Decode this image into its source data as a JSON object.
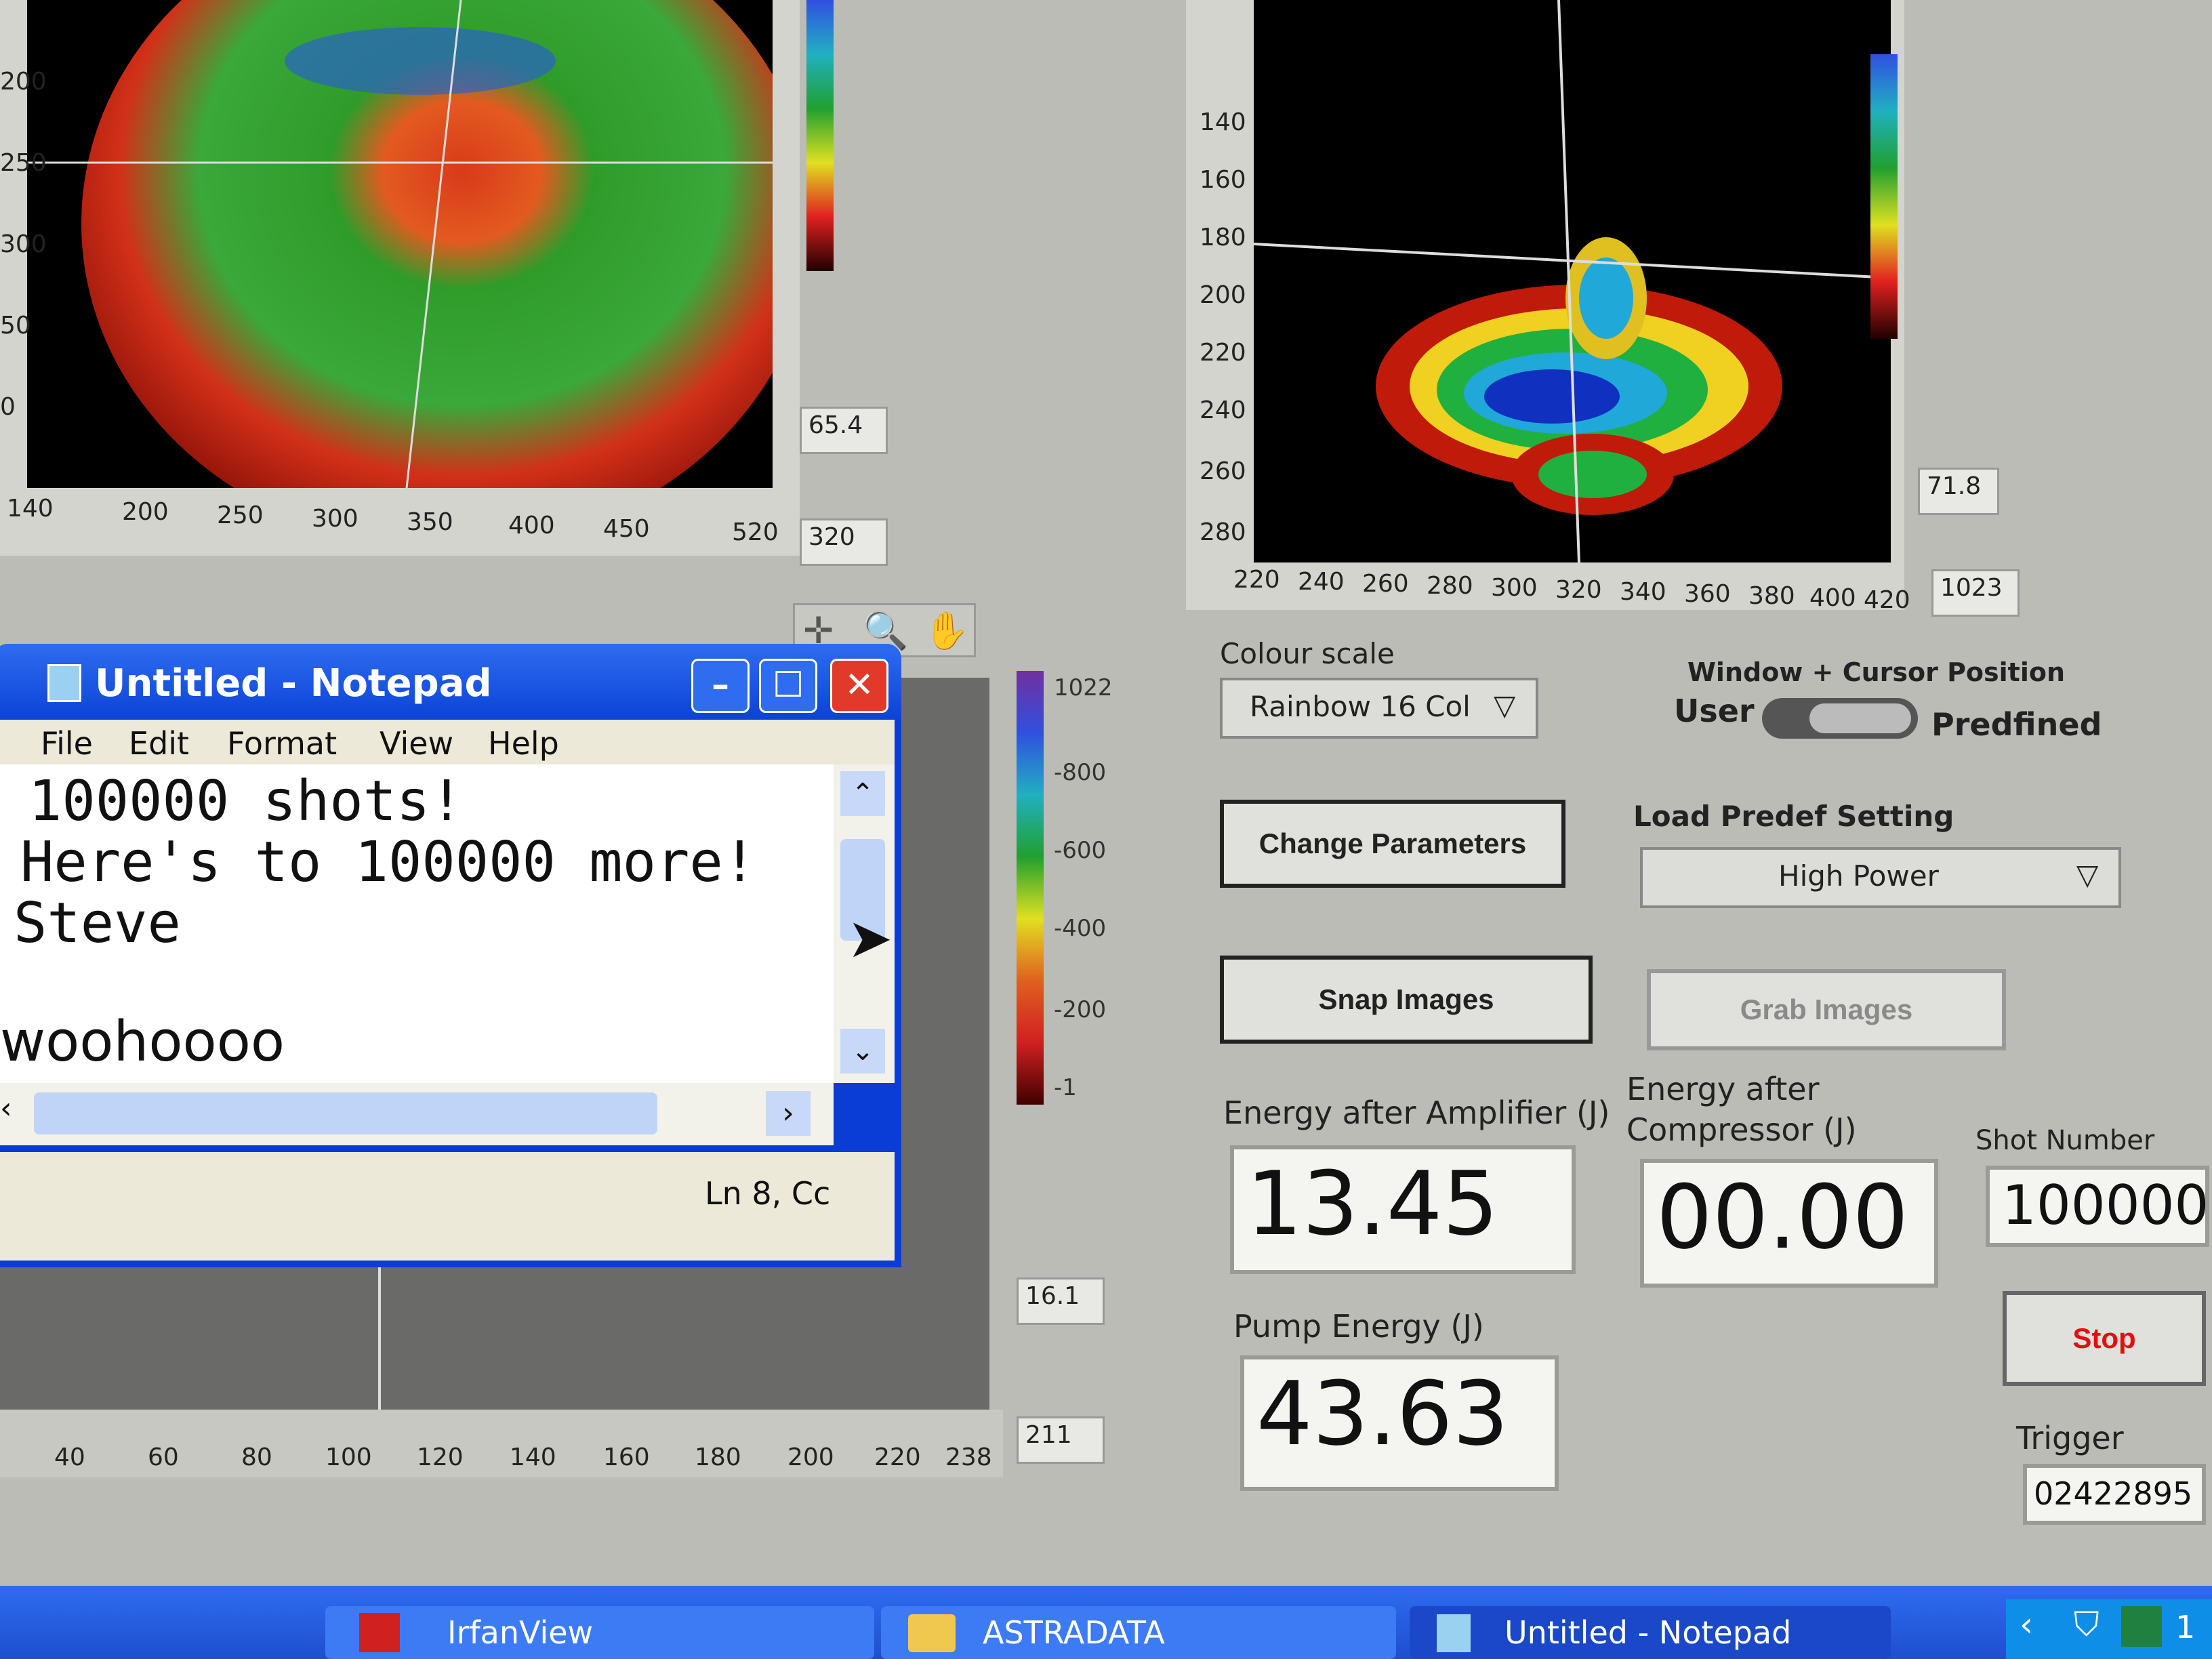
{
  "left_image_panel": {
    "x_ticks": [
      "140",
      "200",
      "250",
      "300",
      "350",
      "400",
      "450",
      "520"
    ],
    "y_ticks": [
      "200",
      "250",
      "300",
      "50",
      "0"
    ],
    "readout_top": "65.4",
    "readout_bottom": "320"
  },
  "right_image_panel": {
    "x_ticks": [
      "220",
      "240",
      "260",
      "280",
      "300",
      "320",
      "340",
      "360",
      "380",
      "400",
      "420"
    ],
    "y_ticks": [
      "140",
      "160",
      "180",
      "200",
      "220",
      "240",
      "260",
      "280"
    ],
    "readout_top": "71.8",
    "readout_bottom": "1023"
  },
  "lower_plot": {
    "colorbar_labels": [
      "1022",
      "-800",
      "-600",
      "-400",
      "-200",
      "-1"
    ],
    "x_ticks": [
      "40",
      "60",
      "80",
      "100",
      "120",
      "140",
      "160",
      "180",
      "200",
      "220",
      "238"
    ],
    "readout_top": "16.1",
    "readout_bottom": "211"
  },
  "notepad": {
    "title": "Untitled - Notepad",
    "menu": [
      "File",
      "Edit",
      "Format",
      "View",
      "Help"
    ],
    "lines": [
      "100000 shots!",
      "Here's to 100000 more!",
      "Steve",
      "",
      "woohoooo"
    ],
    "status": "Ln 8, Cc"
  },
  "controls": {
    "colour_scale_label": "Colour scale",
    "colour_scale_value": "Rainbow 16 Col",
    "window_cursor_label": "Window + Cursor Position",
    "toggle_left": "User",
    "toggle_right": "Predfined",
    "change_parameters": "Change Parameters",
    "load_predef_label": "Load Predef Setting",
    "load_predef_value": "High Power",
    "snap_images": "Snap Images",
    "grab_images": "Grab Images",
    "energy_amp_label": "Energy after Amplifier (J)",
    "energy_amp_value": "13.45",
    "energy_comp_label_1": "Energy after",
    "energy_comp_label_2": "Compressor (J)",
    "energy_comp_value": "00.00",
    "shot_number_label": "Shot Number",
    "shot_number_value": "100000",
    "pump_energy_label": "Pump Energy (J)",
    "pump_energy_value": "43.63",
    "stop": "Stop",
    "trigger_label": "Trigger",
    "trigger_value": "02422895"
  },
  "taskbar": {
    "items": [
      "IrfanView",
      "ASTRADATA",
      "Untitled - Notepad"
    ],
    "tray_text": "1"
  },
  "colors": {
    "taskbar_blue": "#2f6cf0",
    "stop_red": "#e01010",
    "close_red": "#e23a2a"
  }
}
